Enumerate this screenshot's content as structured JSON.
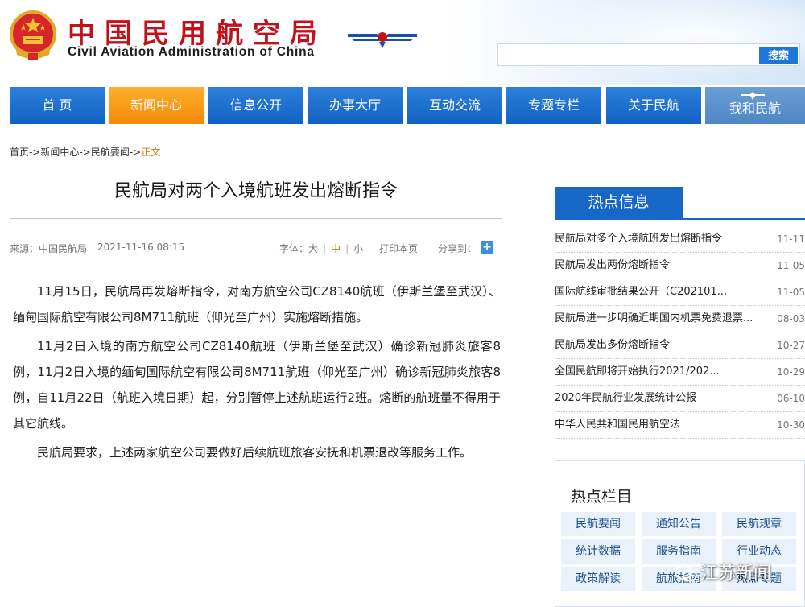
{
  "header": {
    "title_cn": "中国民用航空局",
    "title_en": "Civil Aviation Administration of China",
    "search_placeholder": "",
    "search_button": "搜索"
  },
  "nav": [
    {
      "label": "首 页"
    },
    {
      "label": "新闻中心"
    },
    {
      "label": "信息公开"
    },
    {
      "label": "办事大厅"
    },
    {
      "label": "互动交流"
    },
    {
      "label": "专题专栏"
    },
    {
      "label": "关于民航"
    },
    {
      "label": "我和民航"
    }
  ],
  "breadcrumb": {
    "items": [
      "首页",
      "新闻中心",
      "民航要闻"
    ],
    "separator": "->",
    "current": "正文"
  },
  "article": {
    "title": "民航局对两个入境航班发出熔断指令",
    "source": "来源：中国民航局",
    "time": "2021-11-16 08:15",
    "font_label": "字体：",
    "font_large": "大",
    "font_mid": "中",
    "font_small": "小",
    "print": "打印本页",
    "share": "分享到：",
    "paragraphs": [
      "11月15日，民航局再发熔断指令，对南方航空公司CZ8140航班（伊斯兰堡至武汉）、缅甸国际航空有限公司8M711航班（仰光至广州）实施熔断措施。",
      "11月2日入境的南方航空公司CZ8140航班（伊斯兰堡至武汉）确诊新冠肺炎旅客8例，11月2日入境的缅甸国际航空有限公司8M711航班（仰光至广州）确诊新冠肺炎旅客8例，自11月22日（航班入境日期）起，分别暂停上述航班运行2班。熔断的航班量不得用于其它航线。",
      "民航局要求，上述两家航空公司要做好后续航班旅客安抚和机票退改等服务工作。"
    ]
  },
  "hot_info": {
    "title": "热点信息",
    "items": [
      {
        "title": "民航局对多个入境航班发出熔断指令",
        "date": "11-11"
      },
      {
        "title": "民航局发出两份熔断指令",
        "date": "11-05"
      },
      {
        "title": "国际航线审批结果公开（C202101...",
        "date": "11-05"
      },
      {
        "title": "民航局进一步明确近期国内机票免费退票...",
        "date": "08-03"
      },
      {
        "title": "民航局发出多份熔断指令",
        "date": "10-27"
      },
      {
        "title": "全国民航即将开始执行2021/202...",
        "date": "10-29"
      },
      {
        "title": "2020年民航行业发展统计公报",
        "date": "06-10"
      },
      {
        "title": "中华人民共和国民用航空法",
        "date": "10-30"
      }
    ]
  },
  "hot_columns": {
    "title": "热点栏目",
    "items": [
      {
        "label": "民航要闻"
      },
      {
        "label": "通知公告"
      },
      {
        "label": "民航规章"
      },
      {
        "label": "统计数据"
      },
      {
        "label": "服务指南"
      },
      {
        "label": "行业动态"
      },
      {
        "label": "政策解读"
      },
      {
        "label": "航旅指南"
      },
      {
        "label": "热点专题"
      }
    ]
  },
  "watermark": {
    "text": "江苏新闻"
  },
  "colors": {
    "brand_red": "#c1121b",
    "nav_blue": "#1767c6",
    "nav_active_orange": "#f28a0a",
    "link_orange": "#e26e00"
  }
}
